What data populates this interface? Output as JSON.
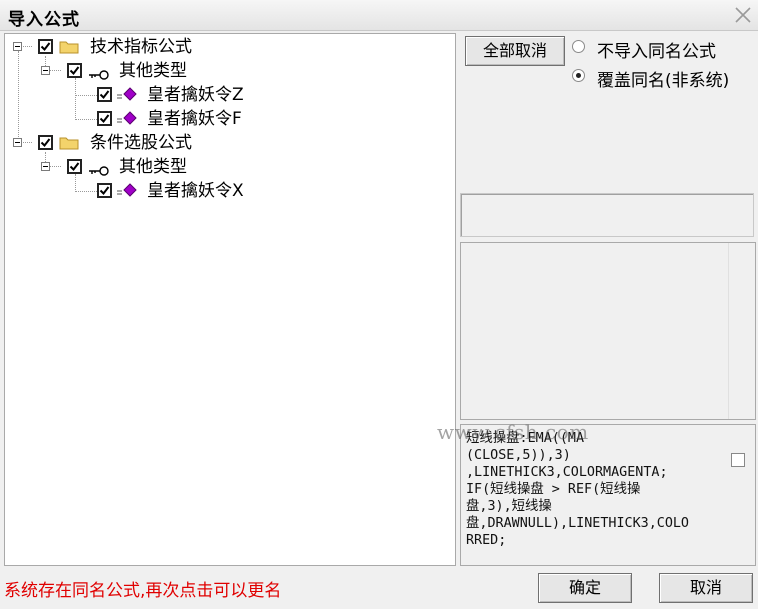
{
  "window": {
    "title": "导入公式"
  },
  "tree": [
    {
      "label": "技术指标公式",
      "kind": "folder",
      "checked": true
    },
    {
      "label": "其他类型",
      "kind": "key",
      "checked": true
    },
    {
      "label": "皇者擒妖令Z",
      "kind": "formula",
      "checked": true
    },
    {
      "label": "皇者擒妖令F",
      "kind": "formula",
      "checked": true
    },
    {
      "label": "条件选股公式",
      "kind": "folder",
      "checked": true
    },
    {
      "label": "其他类型",
      "kind": "key",
      "checked": true
    },
    {
      "label": "皇者擒妖令X",
      "kind": "formula",
      "checked": true
    }
  ],
  "buttons": {
    "deselect_all": "全部取消",
    "ok": "确定",
    "cancel": "取消"
  },
  "options": [
    {
      "label": "不导入同名公式",
      "selected": false
    },
    {
      "label": "覆盖同名(非系统)",
      "selected": true
    }
  ],
  "code": "短线操盘:EMA((MA\n(CLOSE,5)),3)\n,LINETHICK3,COLORMAGENTA;\nIF(短线操盘 > REF(短线操\n盘,3),短线操\n盘,DRAWNULL),LINETHICK3,COLO\nRRED;",
  "watermark": "www.cfsh.com",
  "status_message": "系统存在同名公式,再次点击可以更名",
  "colors": {
    "status": "#e00000",
    "gem": "#a000c8",
    "folder": "#f3d36b"
  }
}
